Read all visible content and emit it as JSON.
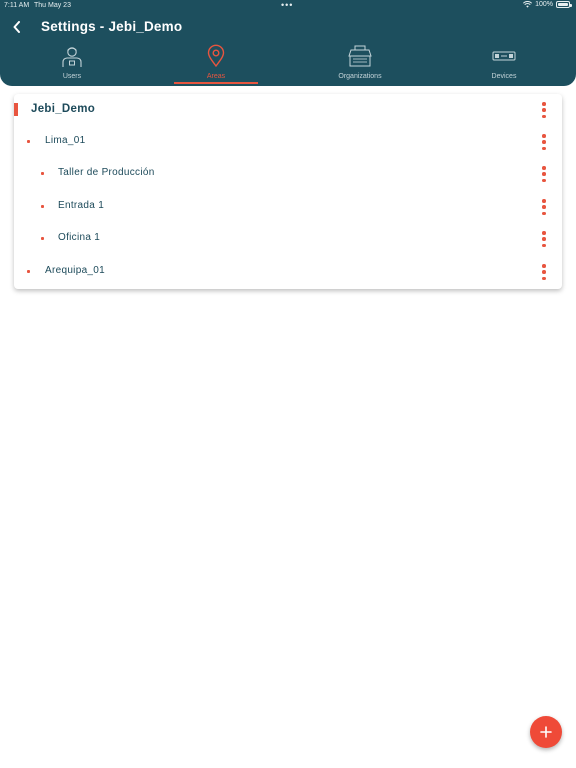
{
  "status_bar": {
    "time": "7:11 AM",
    "date": "Thu May 23",
    "dots": "•••",
    "battery": "100%"
  },
  "header": {
    "title": "Settings - Jebi_Demo",
    "back_icon": "chevron-left-icon"
  },
  "tabs": [
    {
      "label": "Users",
      "icon": "user-icon",
      "active": false
    },
    {
      "label": "Areas",
      "icon": "location-pin-icon",
      "active": true
    },
    {
      "label": "Organizations",
      "icon": "organization-icon",
      "active": false
    },
    {
      "label": "Devices",
      "icon": "device-icon",
      "active": false
    }
  ],
  "tree": [
    {
      "label": "Jebi_Demo",
      "level": 0
    },
    {
      "label": "Lima_01",
      "level": 1
    },
    {
      "label": "Taller de Producción",
      "level": 2
    },
    {
      "label": "Entrada 1",
      "level": 2
    },
    {
      "label": "Oficina 1",
      "level": 2
    },
    {
      "label": "Arequipa_01",
      "level": 1
    }
  ],
  "fab": {
    "icon": "plus-icon"
  },
  "colors": {
    "header_bg": "#1d4f5e",
    "accent": "#e8553f",
    "text_dark": "#1d4a5a",
    "tab_inactive": "#c4d4d9"
  }
}
